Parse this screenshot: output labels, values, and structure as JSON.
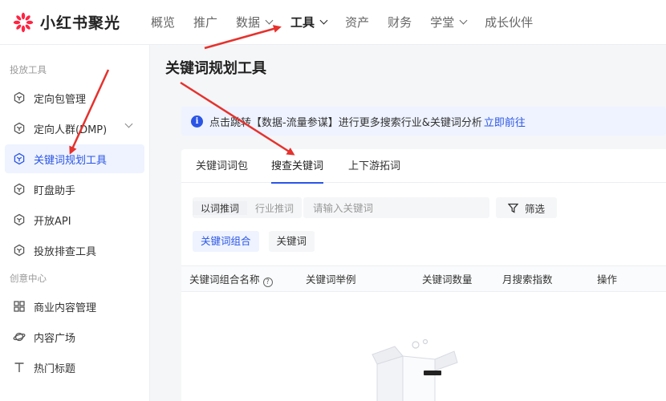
{
  "brand": {
    "name": "小红书聚光",
    "accent": "#2a55e5",
    "logo_color": "#ff2442"
  },
  "nav": {
    "items": [
      {
        "label": "概览",
        "has_dropdown": false,
        "active": false
      },
      {
        "label": "推广",
        "has_dropdown": false,
        "active": false
      },
      {
        "label": "数据",
        "has_dropdown": true,
        "active": false
      },
      {
        "label": "工具",
        "has_dropdown": true,
        "active": true
      },
      {
        "label": "资产",
        "has_dropdown": false,
        "active": false
      },
      {
        "label": "财务",
        "has_dropdown": false,
        "active": false
      },
      {
        "label": "学堂",
        "has_dropdown": true,
        "active": false
      },
      {
        "label": "成长伙伴",
        "has_dropdown": false,
        "active": false
      }
    ]
  },
  "sidebar": {
    "sections": [
      {
        "title": "投放工具"
      },
      {
        "title": "创意中心"
      }
    ],
    "items": [
      {
        "label": "定向包管理",
        "icon": "hexagon-icon"
      },
      {
        "label": "定向人群(DMP)",
        "icon": "hexagon-icon",
        "expandable": true
      },
      {
        "label": "关键词规划工具",
        "icon": "hexagon-icon",
        "active": true
      },
      {
        "label": "盯盘助手",
        "icon": "hexagon-icon"
      },
      {
        "label": "开放API",
        "icon": "hexagon-icon"
      },
      {
        "label": "投放排查工具",
        "icon": "hexagon-icon"
      },
      {
        "label": "商业内容管理",
        "icon": "grid-icon"
      },
      {
        "label": "内容广场",
        "icon": "planet-icon"
      },
      {
        "label": "热门标题",
        "icon": "text-icon"
      }
    ]
  },
  "page": {
    "title": "关键词规划工具",
    "banner": {
      "text": "点击跳转【数据-流量参谋】进行更多搜索行业&关键词分析",
      "link": "立即前往"
    }
  },
  "tabs": [
    {
      "label": "关键词词包",
      "active": false
    },
    {
      "label": "搜查关键词",
      "active": true
    },
    {
      "label": "上下游拓词",
      "active": false
    }
  ],
  "search": {
    "modes": [
      {
        "label": "以词推词",
        "active": true
      },
      {
        "label": "行业推词",
        "active": false
      }
    ],
    "placeholder": "请输入关键词",
    "value": "",
    "filter_label": "筛选"
  },
  "chips": [
    {
      "label": "关键词组合",
      "active": true
    },
    {
      "label": "关键词",
      "active": false
    }
  ],
  "table": {
    "columns": [
      "关键词组合名称",
      "关键词举例",
      "关键词数量",
      "月搜索指数",
      "操作"
    ],
    "rows": []
  }
}
